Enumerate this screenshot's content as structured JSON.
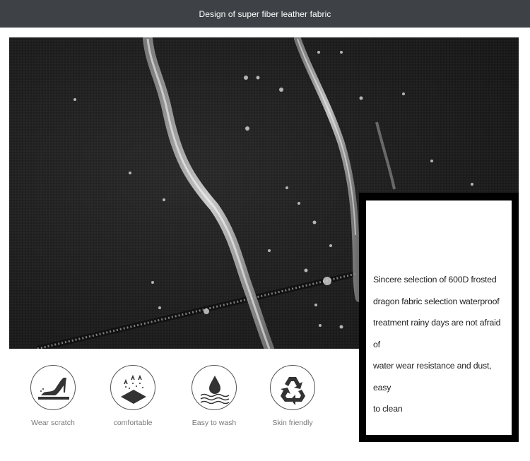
{
  "header": {
    "title": "Design of super fiber leather fabric"
  },
  "photo": {
    "subject": "waterproof fabric with zipper"
  },
  "text_box": {
    "lines": [
      "Sincere selection of 600D frosted",
      "dragon fabric selection waterproof",
      "treatment rainy days are not afraid of",
      "water wear resistance and dust, easy",
      "to clean"
    ]
  },
  "features": [
    {
      "icon": "high-heel-icon",
      "label": "Wear scratch"
    },
    {
      "icon": "breathable-icon",
      "label": "comfortable"
    },
    {
      "icon": "water-drop-icon",
      "label": "Easy to wash"
    },
    {
      "icon": "recycle-icon",
      "label": "Skin friendly"
    }
  ],
  "colors": {
    "header_bg": "#3e4246",
    "fabric": "#232323",
    "icon_stroke": "#555555",
    "label_text": "#777777"
  }
}
